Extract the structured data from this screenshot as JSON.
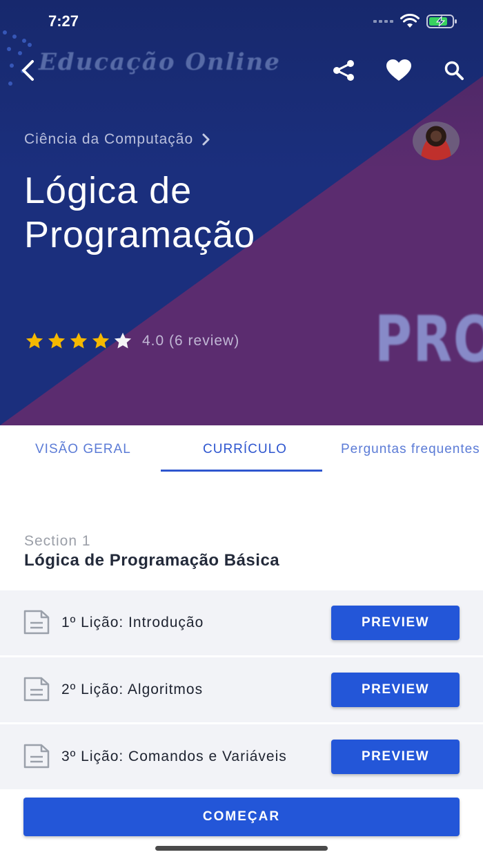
{
  "status_bar": {
    "time": "7:27"
  },
  "header": {
    "background_brand_text": "Educação Online",
    "background_banner_text": "PRO",
    "icons": {
      "back": "back-chevron-icon",
      "share": "share-icon",
      "favorite": "heart-icon",
      "search": "search-icon"
    }
  },
  "course": {
    "category": "Ciência da Computação",
    "title": "Lógica de Programação",
    "rating": 4.0,
    "rating_max": 5,
    "rating_text": "4.0 (6 review)"
  },
  "tabs": [
    {
      "label": "VISÃO GERAL"
    },
    {
      "label": "CURRÍCULO",
      "active": true
    },
    {
      "label": "Perguntas frequentes"
    }
  ],
  "section": {
    "number_label": "Section 1",
    "title": "Lógica de Programação Básica"
  },
  "lessons": [
    {
      "title": "1º Lição: Introdução",
      "button": "PREVIEW"
    },
    {
      "title": "2º Lição: Algoritmos",
      "button": "PREVIEW"
    },
    {
      "title": "3º Lição: Comandos e Variáveis",
      "button": "PREVIEW"
    }
  ],
  "actions": {
    "start_label": "COMEÇAR"
  },
  "colors": {
    "hero_blue": "#1b2f7d",
    "hero_purple": "#5b2c6f",
    "accent": "#2356d8",
    "star": "#f5b800",
    "tab_text": "#5b7bd6",
    "row_bg": "#f2f3f7"
  }
}
